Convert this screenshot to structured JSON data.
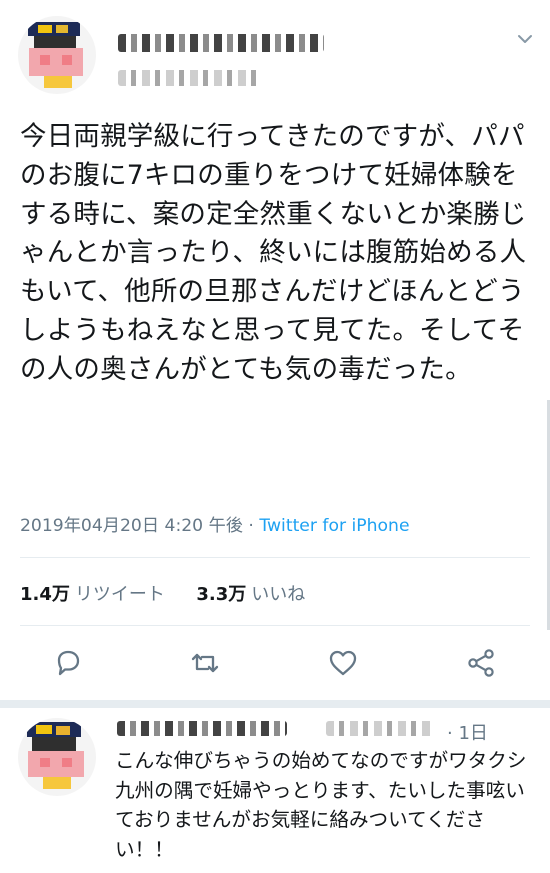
{
  "tweet": {
    "text": "今日両親学級に行ってきたのですが、パパのお腹に7キロの重りをつけて妊婦体験をする時に、案の定全然重くないとか楽勝じゃんとか言ったり、終いには腹筋始める人もいて、他所の旦那さんだけどほんとどうしようもねえなと思って見てた。そしてその人の奥さんがとても気の毒だった。",
    "timestamp": "2019年04月20日 4:20 午後",
    "separator": " · ",
    "source": "Twitter for iPhone",
    "retweets_count": "1.4万",
    "retweets_label": "リツイート",
    "likes_count": "3.3万",
    "likes_label": "いいね"
  },
  "reply": {
    "time": "· 1日",
    "text": "こんな伸びちゃうの始めてなのですがワタクシ九州の隅で妊婦やっとります、たいした事呟いておりませんがお気軽に絡みついてください！！"
  },
  "colors": {
    "text": "#14171a",
    "secondary": "#657786",
    "link": "#1da1f2",
    "divider": "#e6ecf0"
  },
  "icons": {
    "menu": "chevron-down-icon",
    "reply": "reply-icon",
    "retweet": "retweet-icon",
    "like": "heart-icon",
    "share": "share-icon"
  }
}
